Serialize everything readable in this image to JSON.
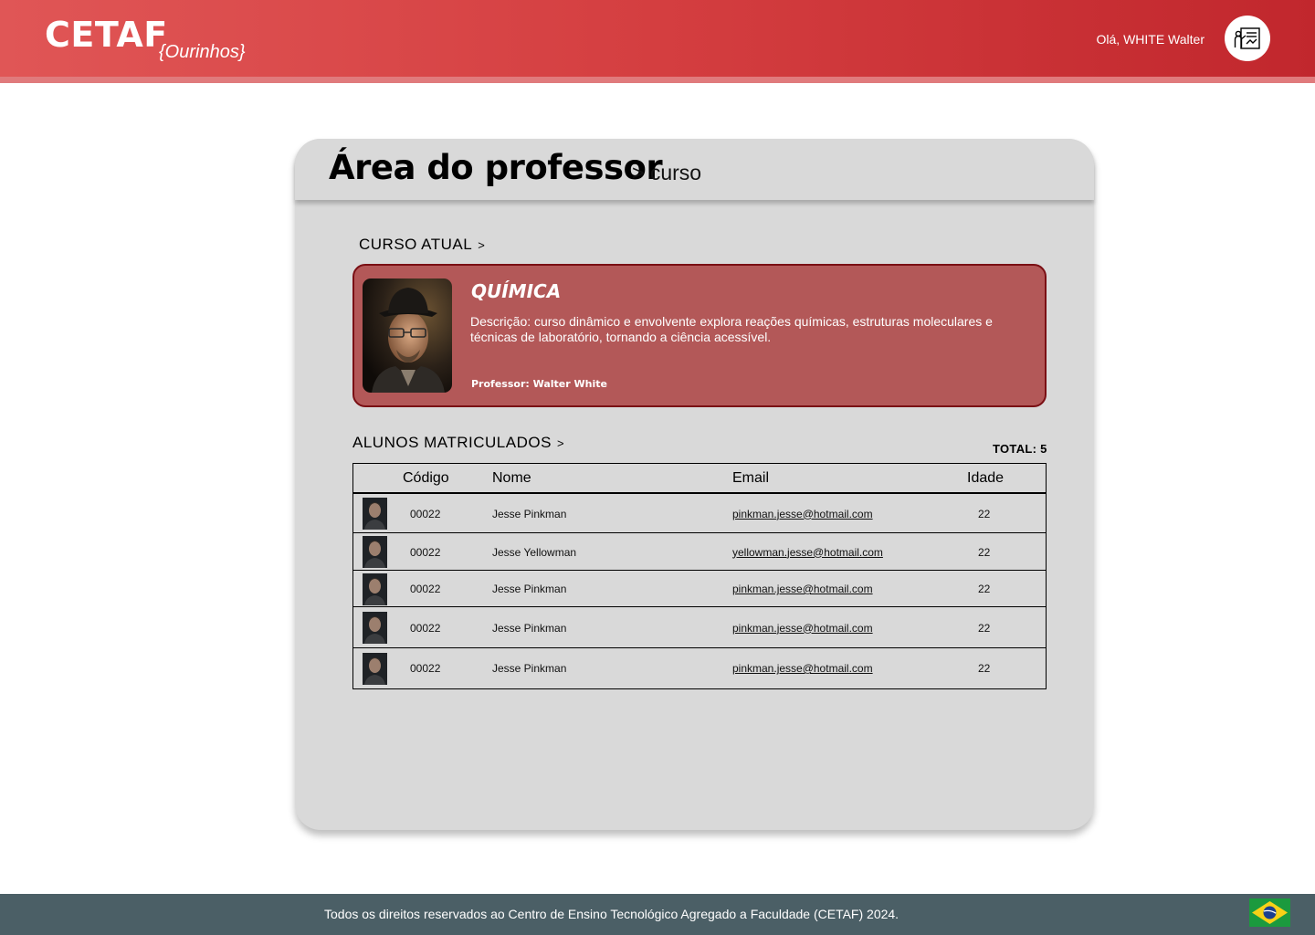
{
  "header": {
    "logo": "CETAF",
    "logo_sub": "{Ourinhos}",
    "greeting": "Olá, WHITE Walter",
    "profile_icon": "teacher-board-icon"
  },
  "panel": {
    "title": "Área do professor",
    "crumb": "> curso"
  },
  "current_course": {
    "label": "CURSO ATUAL",
    "chevron": ">",
    "name": "QUÍMICA",
    "description": "Descrição:  curso dinâmico e envolvente explora reações químicas, estruturas moleculares e técnicas de laboratório, tornando a ciência acessível.",
    "professor": "Professor: Walter White"
  },
  "students": {
    "label": "ALUNOS MATRICULADOS",
    "chevron": ">",
    "total": "TOTAL: 5",
    "columns": [
      "Código",
      "Nome",
      "Email",
      "Idade"
    ],
    "rows": [
      {
        "code": "00022",
        "name": "Jesse Pinkman",
        "email": "pinkman.jesse@hotmail.com",
        "age": "22"
      },
      {
        "code": "00022",
        "name": "Jesse Yellowman",
        "email": "yellowman.jesse@hotmail.com",
        "age": "22"
      },
      {
        "code": "00022",
        "name": "Jesse Pinkman",
        "email": "pinkman.jesse@hotmail.com",
        "age": "22"
      },
      {
        "code": "00022",
        "name": "Jesse Pinkman",
        "email": "pinkman.jesse@hotmail.com",
        "age": "22"
      },
      {
        "code": "00022",
        "name": "Jesse Pinkman",
        "email": "pinkman.jesse@hotmail.com",
        "age": "22"
      }
    ]
  },
  "footer": {
    "text": "Todos os direitos reservados ao Centro de Ensino Tecnológico Agregado a Faculdade (CETAF) 2024.",
    "flag_icon": "brazil-flag-icon"
  },
  "colors": {
    "header_start": "#e05656",
    "header_end": "#c1272d",
    "card": "#b35858",
    "card_border": "#7a0f14",
    "footer": "#4b5f66",
    "panel": "#d9d9d9"
  }
}
